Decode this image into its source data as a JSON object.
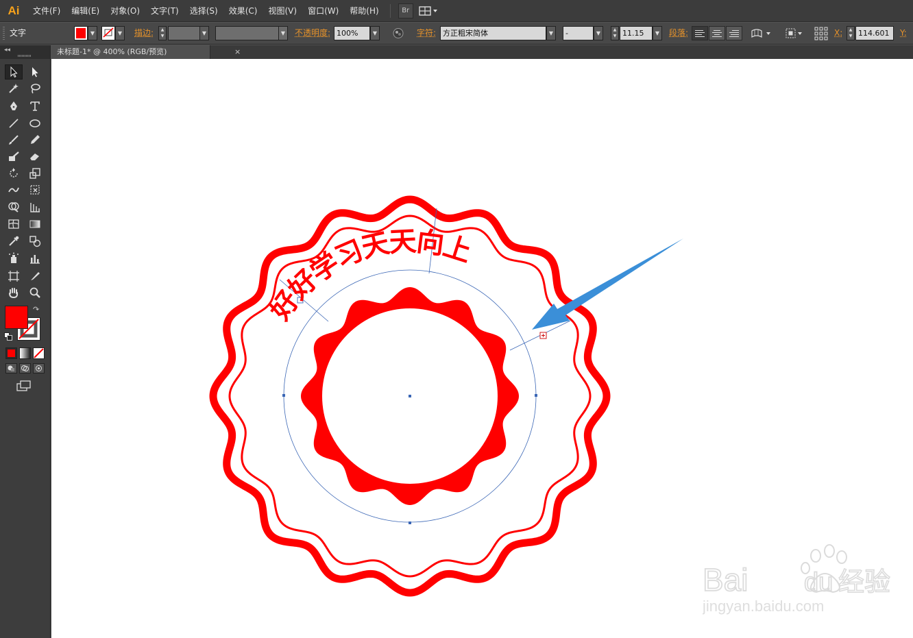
{
  "app": {
    "logo": "Ai",
    "menu": [
      {
        "id": "file",
        "label": "文件(F)"
      },
      {
        "id": "edit",
        "label": "编辑(E)"
      },
      {
        "id": "object",
        "label": "对象(O)"
      },
      {
        "id": "type",
        "label": "文字(T)"
      },
      {
        "id": "select",
        "label": "选择(S)"
      },
      {
        "id": "effect",
        "label": "效果(C)"
      },
      {
        "id": "view",
        "label": "视图(V)"
      },
      {
        "id": "window",
        "label": "窗口(W)"
      },
      {
        "id": "help",
        "label": "帮助(H)"
      }
    ],
    "bridge_label": "Br"
  },
  "control": {
    "mode_label": "文字",
    "fill_color": "#ff0000",
    "stroke_label": "描边:",
    "opacity_label": "不透明度:",
    "opacity_value": "100%",
    "char_label": "字符:",
    "font_family": "方正粗宋简体",
    "font_style": "-",
    "font_size": "11.15",
    "para_label": "段落:",
    "x_label": "X:",
    "x_value": "114.601",
    "y_label": "Y:"
  },
  "tools": {
    "fill_color": "#ff0000",
    "stroke_color": "none"
  },
  "document": {
    "tab_title": "未标题-1* @ 400% (RGB/预览)",
    "close_glyph": "×"
  },
  "artwork": {
    "seal_text": "好好学习天天向上",
    "seal_color": "#ff0000",
    "guide_color": "#3a66b5",
    "arrow_color": "#3b8fd8"
  },
  "watermark": {
    "brand": "Bai",
    "brand2": "du",
    "cn": "经验",
    "url": "jingyan.baidu.com"
  }
}
